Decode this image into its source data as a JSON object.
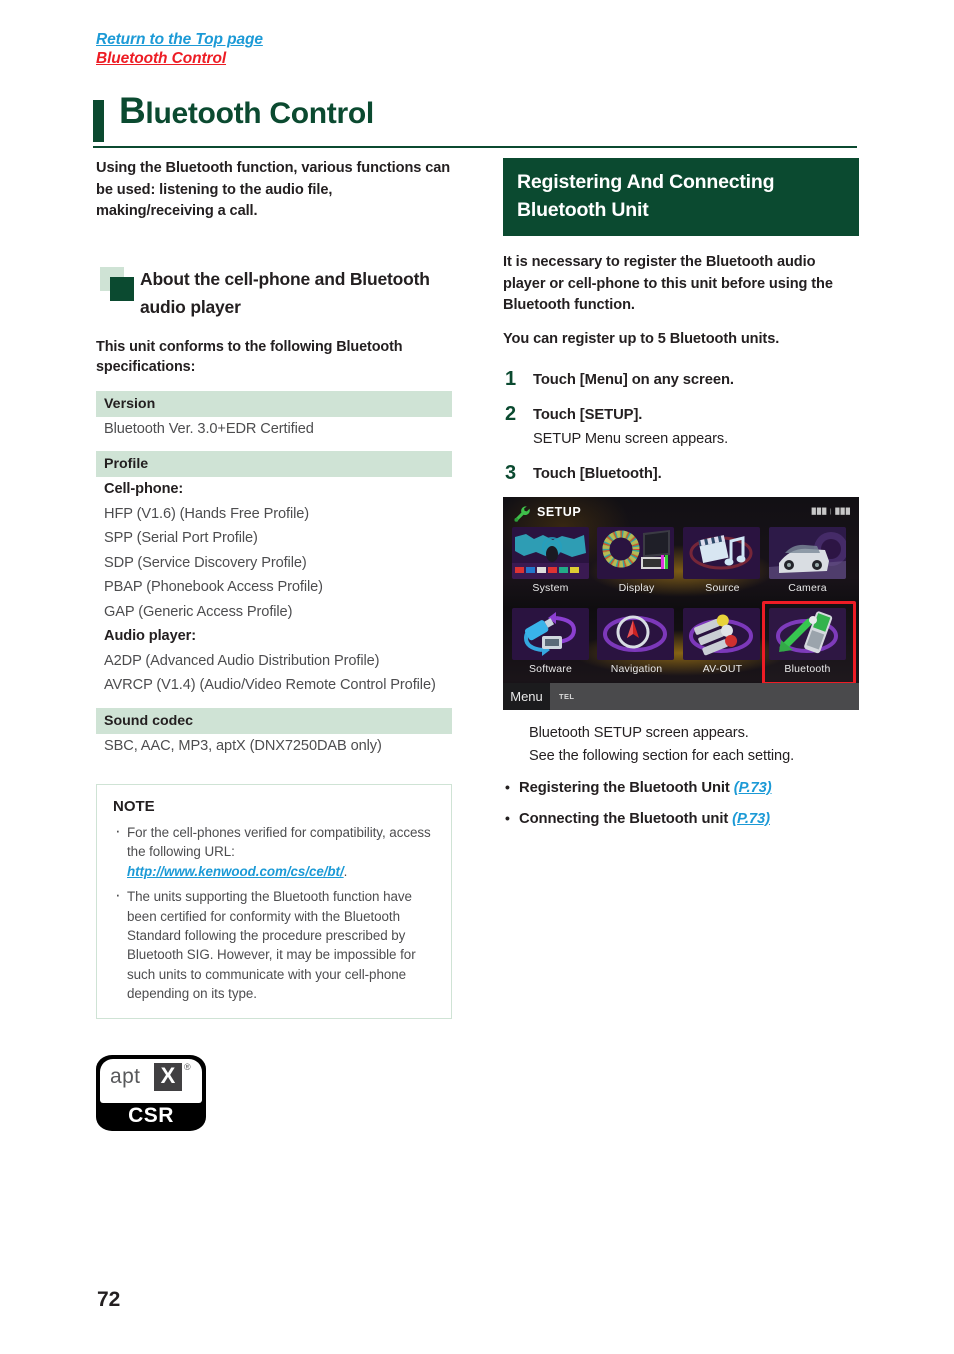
{
  "breadcrumb": {
    "top_link": "Return to the Top page",
    "current": "Bluetooth Control"
  },
  "title": {
    "initial": "B",
    "rest": "luetooth Control"
  },
  "left": {
    "lead": "Using the Bluetooth function, various functions can be used: listening to the audio file, making/receiving a call.",
    "subheading": "About the cell-phone and Bluetooth audio player",
    "intro": "This unit conforms to the following Bluetooth specifications:",
    "spec": [
      {
        "header": "Version",
        "rows": [
          {
            "text": "Bluetooth Ver. 3.0+EDR Certified",
            "bold": false
          }
        ]
      },
      {
        "header": "Profile",
        "rows": [
          {
            "text": "Cell-phone:",
            "bold": true
          },
          {
            "text": "HFP (V1.6) (Hands Free Profile)",
            "bold": false
          },
          {
            "text": "SPP (Serial Port Profile)",
            "bold": false
          },
          {
            "text": "SDP (Service Discovery Profile)",
            "bold": false
          },
          {
            "text": "PBAP (Phonebook Access Profile)",
            "bold": false
          },
          {
            "text": "GAP (Generic Access Profile)",
            "bold": false
          },
          {
            "text": "Audio player:",
            "bold": true
          },
          {
            "text": "A2DP (Advanced Audio Distribution Profile)",
            "bold": false
          },
          {
            "text": "AVRCP (V1.4) (Audio/Video Remote Control Profile)",
            "bold": false
          }
        ]
      },
      {
        "header": "Sound codec",
        "rows": [
          {
            "text": "SBC, AAC, MP3, aptX (DNX7250DAB only)",
            "bold": false
          }
        ]
      }
    ],
    "note": {
      "title": "NOTE",
      "item1_a": "For the cell-phones verified for compatibility, access the following URL: ",
      "item1_link": "http://www.kenwood.com/cs/ce/bt/",
      "item1_b": ".",
      "item2": "The units supporting the Bluetooth function have been certified for conformity with the Bluetooth Standard following the procedure prescribed by Bluetooth SIG. However, it may be impossible for such units to communicate with your cell-phone depending on its type."
    },
    "logo": {
      "apt": "apt",
      "x": "X",
      "registered": "®",
      "csr": "CSR"
    }
  },
  "right": {
    "section_title": "Registering And Connecting Bluetooth Unit",
    "para1": "It is necessary to register the Bluetooth audio player or cell-phone to this unit before using the Bluetooth function.",
    "para2": "You can register up to 5 Bluetooth units.",
    "steps": [
      {
        "num": "1",
        "title": "Touch [Menu] on any screen.",
        "sub": ""
      },
      {
        "num": "2",
        "title": "Touch [SETUP].",
        "sub": "SETUP Menu screen appears."
      },
      {
        "num": "3",
        "title": "Touch [Bluetooth].",
        "sub": ""
      }
    ],
    "screenshot": {
      "title": "SETUP",
      "signal": "███ | ███",
      "tiles": [
        {
          "label": "System"
        },
        {
          "label": "Display"
        },
        {
          "label": "Source"
        },
        {
          "label": "Camera"
        },
        {
          "label": "Software"
        },
        {
          "label": "Navigation"
        },
        {
          "label": "AV-OUT"
        },
        {
          "label": "Bluetooth"
        }
      ],
      "menu_button": "Menu",
      "tel_label": "TEL",
      "highlight_color": "#ee1c25"
    },
    "after_shot": [
      "Bluetooth SETUP screen appears.",
      "See the following section for each setting."
    ],
    "bullets": [
      {
        "text": "Registering the Bluetooth Unit ",
        "ref": "(P.73)"
      },
      {
        "text": "Connecting the Bluetooth unit ",
        "ref": "(P.73)"
      }
    ]
  },
  "footer": {
    "page_number": "72"
  },
  "colors": {
    "dark_green": "#0b4a30",
    "light_green": "#cfe3d5",
    "link_blue": "#1c9ad6",
    "link_red": "#ed1c24"
  }
}
